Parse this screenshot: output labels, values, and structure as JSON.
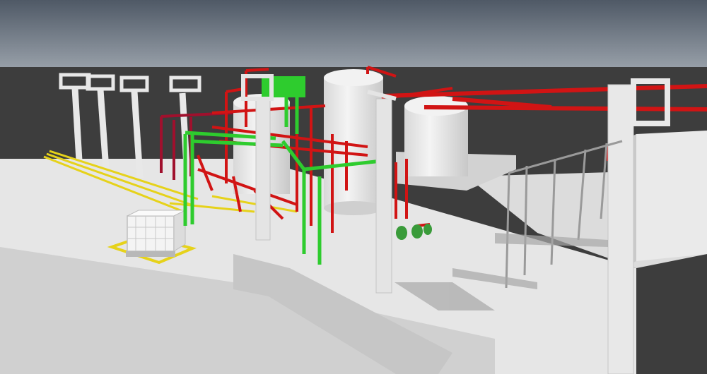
{
  "scene": {
    "description_visible_text": "",
    "colors": {
      "sky_top": "#4f5966",
      "sky_bottom": "#9aa2ab",
      "horizon": "#3a3a3a",
      "ground_dark": "#3d3d3d",
      "slab_light": "#e9e9e9",
      "slab_mid": "#d4d4d4",
      "slab_shadow": "#b9b9b9",
      "tank": "#eeeeee",
      "tank_shade": "#cfcfcf",
      "pipe_red": "#d11414",
      "pipe_dark_red": "#a0102d",
      "pipe_green": "#2ecc2e",
      "pipe_yellow": "#e6d21a",
      "steel_light": "#e4e4e4",
      "steel_dark": "#8c8c8c",
      "ibc_cage": "#f2f2f2",
      "ibc_pallet": "#b8b8b8",
      "shadow": "#8e8e8e"
    }
  }
}
